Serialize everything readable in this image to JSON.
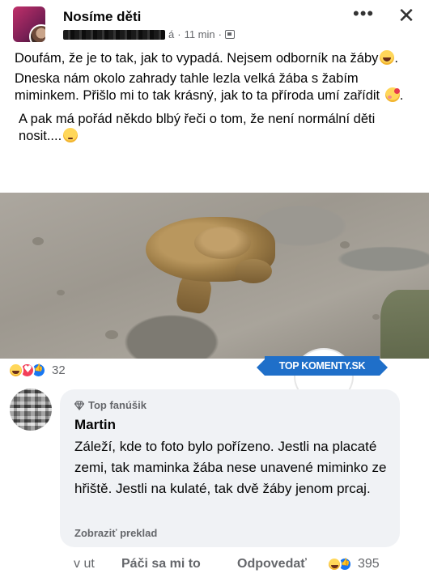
{
  "post": {
    "group_name": "Nosíme děti",
    "author_suffix": "á",
    "time": "11 min",
    "meta_sep": "·",
    "more_icon": "more-horizontal-icon",
    "close_icon": "close-icon",
    "paragraphs": {
      "p1": "Doufám, že je to tak, jak to vypadá. Nejsem odborník na žáby",
      "p2": "Dneska nám okolo zahrady tahle lezla velká žába s žabím miminkem. Přišlo mi to tak krásný, jak to ta příroda umí zařídit",
      "p3": "A pak má pořád někdo blbý řeči o tom, že není normální děti nosit...."
    },
    "emojis": [
      "grinning-squinting-face",
      "smiling-face-with-hearts",
      "pensive-face"
    ]
  },
  "reactions": {
    "icons": [
      "haha",
      "love",
      "like"
    ],
    "count": "32"
  },
  "watermark": {
    "text": "TOP KOMENTY.SK"
  },
  "comment": {
    "badge": "Top fanúšik",
    "author": "Martin",
    "text": "Záleží, kde to foto bylo pořízeno. Jestli na placaté zemi, tak maminka žába nese unavené miminko ze hřiště. Jestli na kulaté, tak dvě žáby jenom prcaj.",
    "translate": "Zobraziť preklad",
    "actions": {
      "time": "v ut",
      "like": "Páči sa mi to",
      "reply": "Odpovedať",
      "reaction_count": "395"
    }
  },
  "colors": {
    "link_blue": "#1877f2",
    "heart_red": "#f33e58",
    "secondary_text": "#65676b",
    "bubble_bg": "#f0f2f5",
    "watermark_blue": "#1f6fc9"
  }
}
